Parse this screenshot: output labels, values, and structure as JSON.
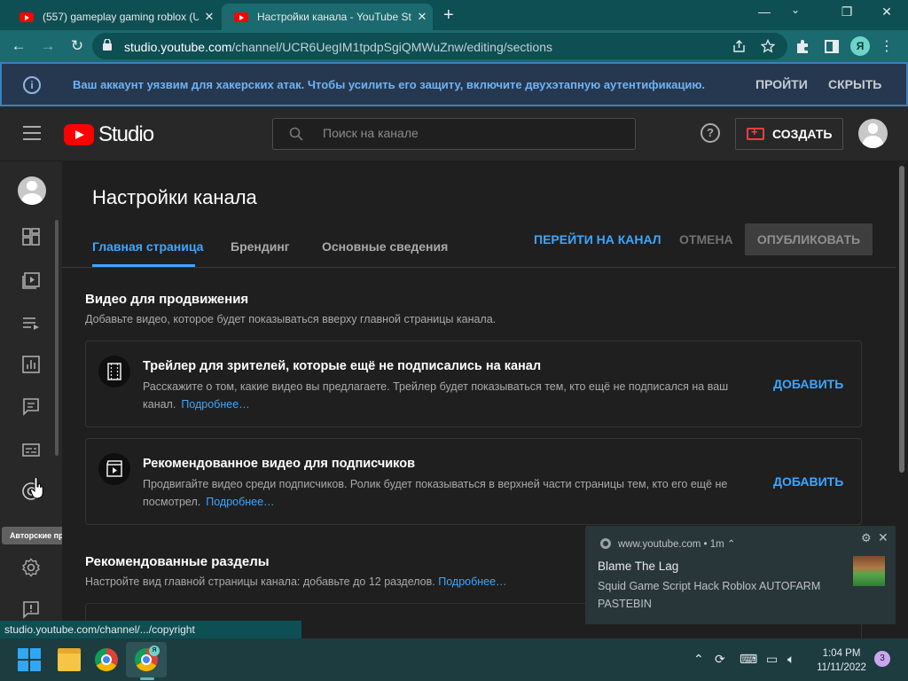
{
  "browser": {
    "tabs": [
      {
        "title": "(557) gameplay gaming roblox (U",
        "close": "✕"
      },
      {
        "title": "Настройки канала - YouTube Stu",
        "close": "✕"
      }
    ],
    "new_tab": "+",
    "window": {
      "minimize": "—",
      "maximize": "❐",
      "close": "✕"
    },
    "url_host": "studio.youtube.com",
    "url_path": "/channel/UCR6UegIM1tpdpSgiQMWuZnw/editing/sections",
    "profile_letter": "Я",
    "status_url": "studio.youtube.com/channel/.../copyright"
  },
  "banner": {
    "message": "Ваш аккаунт уязвим для хакерских атак. Чтобы усилить его защиту, включите двухэтапную аутентификацию.",
    "go_label": "ПРОЙТИ",
    "hide_label": "СКРЫТЬ",
    "info_glyph": "i"
  },
  "studio": {
    "logo_text": "Studio",
    "search_placeholder": "Поиск на канале",
    "help_glyph": "?",
    "create_label": "СОЗДАТЬ",
    "tooltip": "Авторские права"
  },
  "page": {
    "title": "Настройки канала",
    "tabs": [
      "Главная страница",
      "Брендинг",
      "Основные сведения"
    ],
    "active_tab": "Главная страница",
    "goto_channel": "ПЕРЕЙТИ НА КАНАЛ",
    "cancel": "ОТМЕНА",
    "publish": "ОПУБЛИКОВАТЬ"
  },
  "sections": {
    "promo": {
      "title": "Видео для продвижения",
      "desc": "Добавьте видео, которое будет показываться вверху главной страницы канала."
    },
    "cards": [
      {
        "title": "Трейлер для зрителей, которые ещё не подписались на канал",
        "desc": "Расскажите о том, какие видео вы предлагаете. Трейлер будет показываться тем, кто ещё не подписался на ваш канал.",
        "more": "Подробнее…",
        "add": "ДОБАВИТЬ"
      },
      {
        "title": "Рекомендованное видео для подписчиков",
        "desc": "Продвигайте видео среди подписчиков. Ролик будет показываться в верхней части страницы тем, кто его ещё не посмотрел.",
        "more": "Подробнее…",
        "add": "ДОБАВИТЬ"
      }
    ],
    "featured": {
      "title": "Рекомендованные разделы",
      "desc": "Настройте вид главной страницы канала: добавьте до 12 разделов.",
      "more": "Подробнее…"
    }
  },
  "notification": {
    "source": "www.youtube.com",
    "time": "1m",
    "title": "Blame The Lag",
    "body": "Squid Game Script Hack Roblox AUTOFARM PASTEBIN",
    "gear": "⚙",
    "close": "✕"
  },
  "taskbar": {
    "time": "1:04 PM",
    "date": "11/11/2022",
    "notification_count": "3",
    "ya_badge": "Я"
  },
  "icons": [
    "menu-icon",
    "search-icon",
    "help-icon",
    "video-camera-plus-icon",
    "dashboard-icon",
    "content-icon",
    "playlist-icon",
    "analytics-icon",
    "comments-icon",
    "subtitles-icon",
    "copyright-icon",
    "settings-icon",
    "feedback-icon",
    "film-icon",
    "clapperboard-icon",
    "chrome-icon",
    "lock-icon",
    "share-icon",
    "star-icon",
    "extensions-icon",
    "sidebar-icon",
    "more-vert-icon"
  ]
}
